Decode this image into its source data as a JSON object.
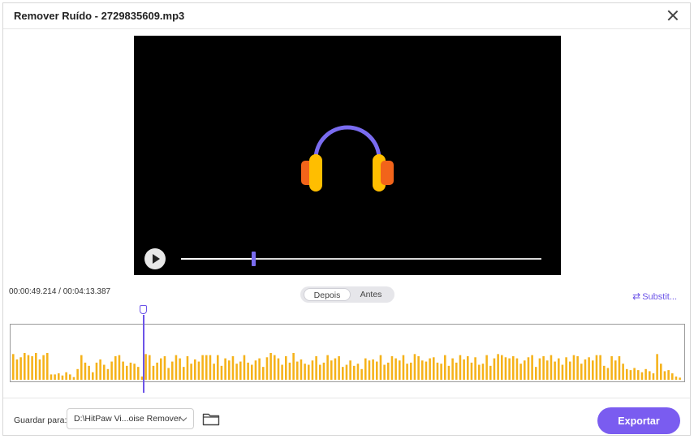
{
  "window": {
    "title": "Remover Ruído - 2729835609.mp3"
  },
  "player": {
    "progress": 0.2
  },
  "timeline": {
    "current": "00:00:49.214",
    "total": "/ 00:04:13.387",
    "toggle": {
      "after": "Depois",
      "before": "Antes",
      "selected": "Depois"
    },
    "replace_label": "Substit...",
    "playhead_fraction": 0.195
  },
  "footer": {
    "save_label": "Guardar para:",
    "save_path": "D:\\HitPaw Vi...oise Remover",
    "export_label": "Exportar"
  },
  "colors": {
    "accent": "#7a5cf0",
    "headphone_band": "#7a6cf0",
    "headphone_cup": "#ffbe00",
    "headphone_cup_outer": "#f2641a",
    "waveform": "#f5b21a"
  },
  "waveform_levels": [
    0.48,
    0.38,
    0.42,
    0.5,
    0.46,
    0.44,
    0.5,
    0.38,
    0.46,
    0.5,
    0.1,
    0.1,
    0.12,
    0.08,
    0.14,
    0.1,
    0.05,
    0.2,
    0.46,
    0.32,
    0.26,
    0.14,
    0.32,
    0.38,
    0.28,
    0.2,
    0.34,
    0.44,
    0.46,
    0.34,
    0.26,
    0.32,
    0.3,
    0.24,
    0.06,
    0.48,
    0.46,
    0.26,
    0.32,
    0.4,
    0.44,
    0.22,
    0.34,
    0.46,
    0.4,
    0.24,
    0.44,
    0.3,
    0.38,
    0.34,
    0.46,
    0.46,
    0.46,
    0.3,
    0.46,
    0.26,
    0.4,
    0.36,
    0.44,
    0.3,
    0.34,
    0.46,
    0.32,
    0.28,
    0.36,
    0.4,
    0.24,
    0.42,
    0.5,
    0.46,
    0.4,
    0.28,
    0.44,
    0.32,
    0.5,
    0.34,
    0.38,
    0.3,
    0.28,
    0.36,
    0.44,
    0.28,
    0.32,
    0.46,
    0.36,
    0.4,
    0.44,
    0.24,
    0.28,
    0.36,
    0.26,
    0.3,
    0.2,
    0.4,
    0.36,
    0.38,
    0.34,
    0.46,
    0.28,
    0.32,
    0.44,
    0.4,
    0.36,
    0.46,
    0.3,
    0.32,
    0.48,
    0.44,
    0.36,
    0.34,
    0.4,
    0.42,
    0.32,
    0.3,
    0.46,
    0.26,
    0.4,
    0.32,
    0.46,
    0.38,
    0.44,
    0.32,
    0.42,
    0.28,
    0.3,
    0.46,
    0.26,
    0.4,
    0.48,
    0.46,
    0.42,
    0.4,
    0.44,
    0.4,
    0.3,
    0.36,
    0.42,
    0.46,
    0.24,
    0.4,
    0.44,
    0.36,
    0.46,
    0.34,
    0.4,
    0.28,
    0.42,
    0.34,
    0.46,
    0.44,
    0.3,
    0.38,
    0.42,
    0.36,
    0.46,
    0.46,
    0.26,
    0.22,
    0.44,
    0.36,
    0.44,
    0.3,
    0.2,
    0.18,
    0.22,
    0.18,
    0.14,
    0.2,
    0.16,
    0.12,
    0.48,
    0.3,
    0.16,
    0.18,
    0.12,
    0.06,
    0.04
  ]
}
